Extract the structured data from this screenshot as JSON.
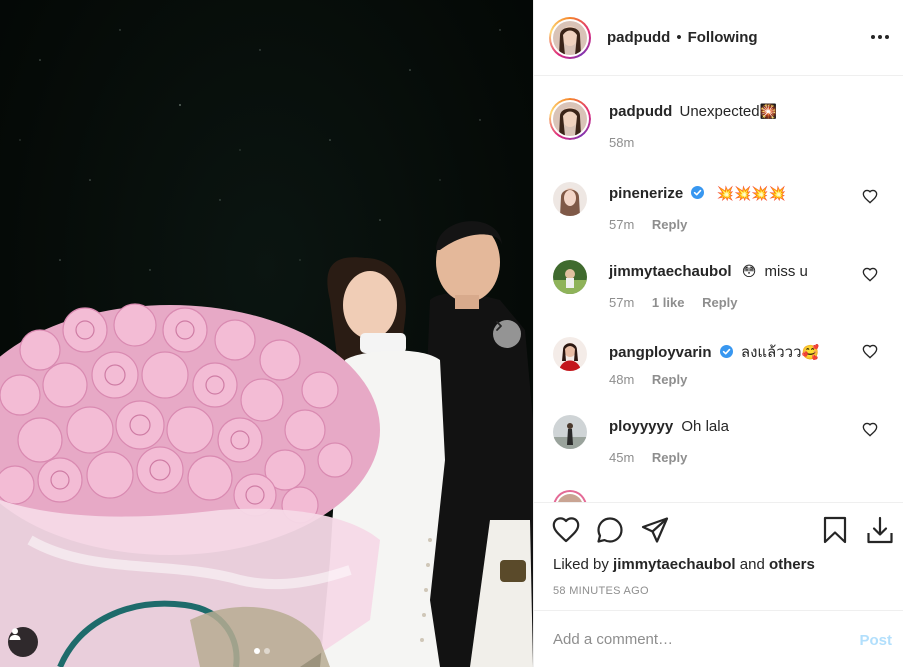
{
  "post": {
    "author": "padpudd",
    "follow_separator": "•",
    "follow_status": "Following",
    "caption": "Unexpected",
    "caption_emoji": "🎇",
    "caption_time": "58m"
  },
  "icons": {
    "more": "more-horizontal-icon",
    "next": "chevron-right-icon",
    "tag": "user-tag-icon",
    "like": "heart-icon",
    "comment": "comment-icon",
    "share": "paper-plane-icon",
    "save": "bookmark-icon",
    "download": "download-icon",
    "verified": "verified-badge-icon"
  },
  "comments": [
    {
      "user": "pinenerize",
      "verified": true,
      "text": "",
      "emoji": "💥💥💥💥",
      "time": "57m",
      "likes": "",
      "reply": "Reply"
    },
    {
      "user": "jimmytaechaubol",
      "verified": false,
      "text": "miss u",
      "emoji": "😳",
      "time": "57m",
      "likes": "1 like",
      "reply": "Reply"
    },
    {
      "user": "pangployvarin",
      "verified": true,
      "text": "ลงแล้ววว",
      "emoji": "🥰",
      "time": "48m",
      "likes": "",
      "reply": "Reply"
    },
    {
      "user": "ployyyyy",
      "verified": false,
      "text": "Oh lala",
      "emoji": "",
      "time": "45m",
      "likes": "",
      "reply": "Reply"
    }
  ],
  "likes": {
    "prefix": "Liked by",
    "user": "jimmytaechaubol",
    "conj": "and",
    "others": "others"
  },
  "timestamp": "58 MINUTES AGO",
  "add_comment": {
    "placeholder": "Add a comment…",
    "post_label": "Post"
  },
  "carousel": {
    "total": 2,
    "current": 1
  },
  "colors": {
    "text": "#262626",
    "muted": "#8e8e8e",
    "post_disabled": "#b2dffc",
    "verified": "#3897f0",
    "border": "#efefef"
  }
}
